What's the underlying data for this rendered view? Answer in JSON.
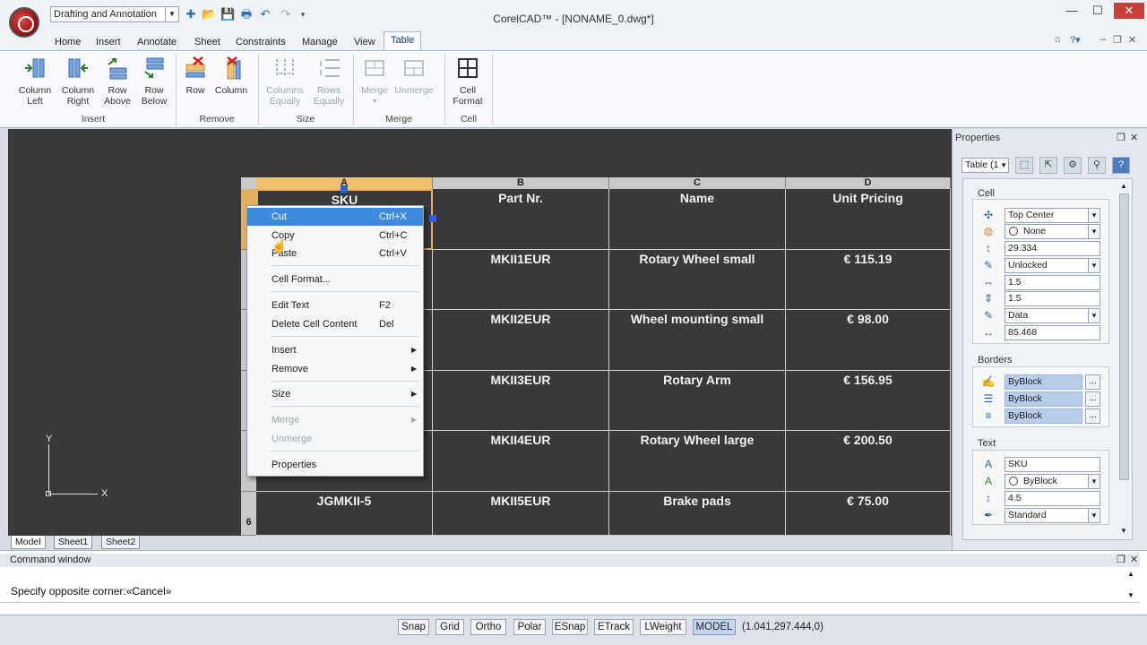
{
  "titlebar": {
    "workspace": "Drafting and Annotation",
    "title": "CorelCAD™ - [NONAME_0.dwg*]",
    "min": "—",
    "max": "☐",
    "close": "✕"
  },
  "ribbon_tabs": [
    "Home",
    "Insert",
    "Annotate",
    "Sheet",
    "Constraints",
    "Manage",
    "View",
    "Table"
  ],
  "ribbon": {
    "buttons": [
      {
        "l1": "Column",
        "l2": "Left"
      },
      {
        "l1": "Column",
        "l2": "Right"
      },
      {
        "l1": "Row",
        "l2": "Above"
      },
      {
        "l1": "Row",
        "l2": "Below"
      },
      {
        "l1": "Row",
        "l2": ""
      },
      {
        "l1": "Column",
        "l2": ""
      },
      {
        "l1": "Columns",
        "l2": "Equally"
      },
      {
        "l1": "Rows",
        "l2": "Equally"
      },
      {
        "l1": "Merge",
        "l2": ""
      },
      {
        "l1": "Unmerge",
        "l2": ""
      },
      {
        "l1": "Cell",
        "l2": "Format"
      }
    ],
    "groups": [
      "Insert",
      "Remove",
      "Size",
      "Merge",
      "Cell"
    ]
  },
  "table": {
    "col_letters": [
      "A",
      "B",
      "C",
      "D"
    ],
    "headers": [
      "SKU",
      "Part Nr.",
      "Name",
      "Unit Pricing"
    ],
    "rows": [
      [
        "",
        "MKII1EUR",
        "Rotary Wheel small",
        "€ 115.19"
      ],
      [
        "",
        "MKII2EUR",
        "Wheel mounting small",
        "€ 98.00"
      ],
      [
        "",
        "MKII3EUR",
        "Rotary Arm",
        "€ 156.95"
      ],
      [
        "",
        "MKII4EUR",
        "Rotary Wheel large",
        "€ 200.50"
      ],
      [
        "JGMKII-5",
        "MKII5EUR",
        "Brake pads",
        "€ 75.00"
      ]
    ],
    "row_label_6": "6"
  },
  "ucs": {
    "x": "X",
    "y": "Y"
  },
  "context_menu": [
    {
      "label": "Cut",
      "shortcut": "Ctrl+X",
      "highlight": true
    },
    {
      "label": "Copy",
      "shortcut": "Ctrl+C"
    },
    {
      "label": "Paste",
      "shortcut": "Ctrl+V"
    },
    {
      "label": "Cell Format...",
      "shortcut": ""
    },
    {
      "label": "Edit Text",
      "shortcut": "F2"
    },
    {
      "label": "Delete Cell Content",
      "shortcut": "Del"
    },
    {
      "label": "Insert",
      "shortcut": "",
      "submenu": true
    },
    {
      "label": "Remove",
      "shortcut": "",
      "submenu": true
    },
    {
      "label": "Size",
      "shortcut": "",
      "submenu": true
    },
    {
      "label": "Merge",
      "shortcut": "",
      "submenu": true,
      "disabled": true
    },
    {
      "label": "Unmerge",
      "shortcut": "",
      "disabled": true
    },
    {
      "label": "Properties",
      "shortcut": ""
    }
  ],
  "sheet_tabs": [
    "Model",
    "Sheet1",
    "Sheet2"
  ],
  "properties": {
    "title": "Properties",
    "selector": "Table (1",
    "sections": {
      "cell": "Cell",
      "borders": "Borders",
      "text": "Text"
    },
    "cell_fields": [
      "Top Center",
      "None",
      "29.334",
      "Unlocked",
      "1.5",
      "1.5",
      "Data",
      "85.468"
    ],
    "border_fields": [
      "ByBlock",
      "ByBlock",
      "ByBlock"
    ],
    "text_fields": [
      "SKU",
      "ByBlock",
      "4.5",
      "Standard"
    ],
    "dots": "..."
  },
  "command": {
    "title": "Command window",
    "line": "Specify opposite corner:«Cancel»"
  },
  "status": {
    "buttons": [
      "Snap",
      "Grid",
      "Ortho",
      "Polar",
      "ESnap",
      "ETrack",
      "LWeight",
      "MODEL"
    ],
    "coords": "(1.041,297.444,0)"
  }
}
